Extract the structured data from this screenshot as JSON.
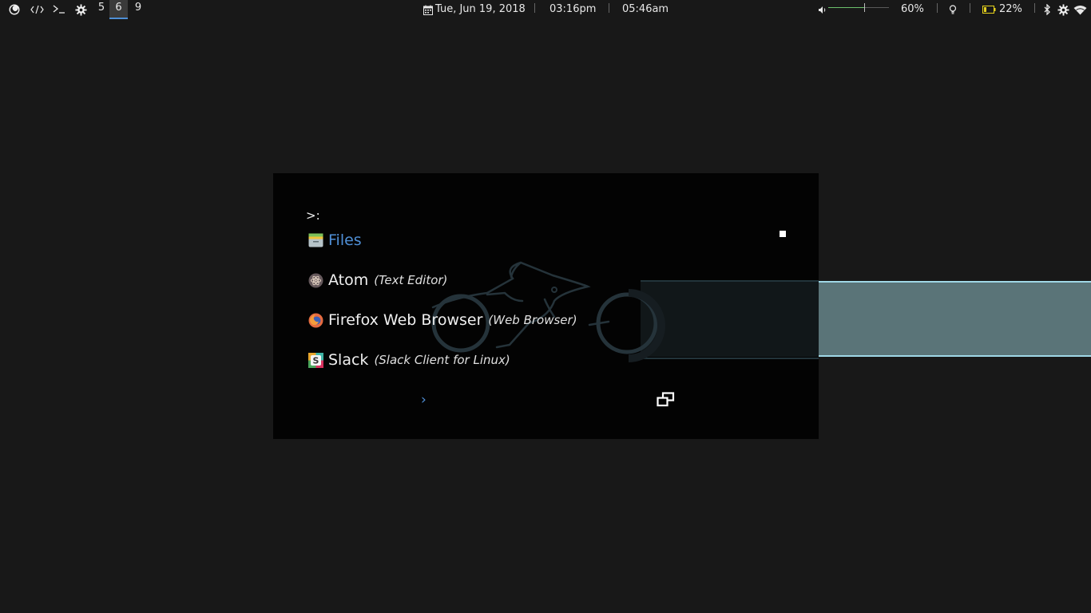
{
  "topbar": {
    "workspaces": [
      {
        "label": "5",
        "active": false
      },
      {
        "label": "6",
        "active": true
      },
      {
        "label": "9",
        "active": false
      }
    ],
    "date": "Tue, Jun 19, 2018",
    "time_local": "03:16pm",
    "time_secondary": "05:46am",
    "volume_percent": "60%",
    "volume_level": 0.6,
    "battery_percent": "22%",
    "colors": {
      "active_workspace_underline": "#4e8fd6",
      "volume_fill": "#6cc06c",
      "battery": "#e5d11d"
    }
  },
  "launcher": {
    "prompt": ">:",
    "items": [
      {
        "name": "Files",
        "description": "",
        "icon": "files-icon",
        "selected": true
      },
      {
        "name": "Atom",
        "description": "(Text Editor)",
        "icon": "atom-icon",
        "selected": false
      },
      {
        "name": "Firefox Web Browser",
        "description": "(Web Browser)",
        "icon": "firefox-icon",
        "selected": false
      },
      {
        "name": "Slack",
        "description": "(Slack Client for Linux)",
        "icon": "slack-icon",
        "selected": false
      }
    ],
    "next_page_glyph": "›",
    "colors": {
      "accent": "#4f8fd6",
      "background": "#030303",
      "light_stream": "#5a7478"
    }
  }
}
